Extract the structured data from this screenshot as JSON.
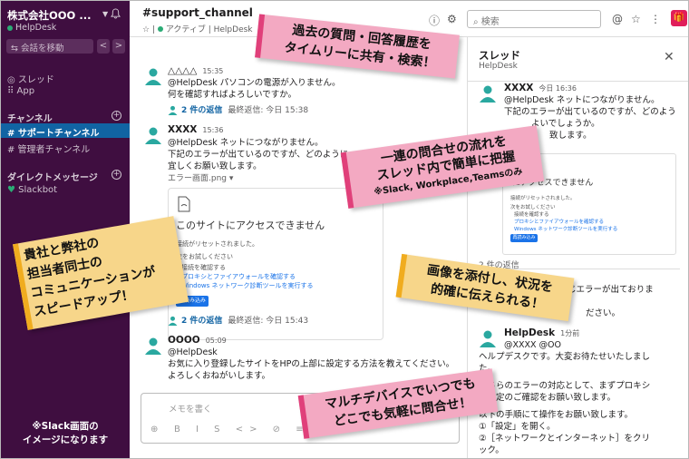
{
  "sidebar": {
    "workspace_name": "株式会社OOO ...",
    "workspace_status": "HelpDesk",
    "jump_label": "会話を移動",
    "threads_label": "スレッド",
    "app_label": "App",
    "channels_header": "チャンネル",
    "channels": [
      {
        "label": "# サポートチャンネル",
        "active": true
      },
      {
        "label": "# 管理者チャンネル",
        "active": false
      }
    ],
    "dm_header": "ダイレクトメッセージ",
    "dm_items": [
      {
        "label": "Slackbot"
      }
    ],
    "note_line1": "※Slack画面の",
    "note_line2": "イメージになります"
  },
  "header": {
    "channel_name": "#support_channel",
    "status": "アクティブ",
    "topic": "HelpDesk",
    "search_placeholder": "検索"
  },
  "messages": [
    {
      "name": "△△△△",
      "time": "15:35",
      "lines": [
        "@HelpDesk パソコンの電源が入りません。",
        "何を確認すればよろしいですか。"
      ],
      "replies": "2 件の返信",
      "last_reply": "最終返信: 今日 15:38"
    },
    {
      "name": "XXXX",
      "time": "15:36",
      "lines": [
        "@HelpDesk ネットにつながりません。",
        "下記のエラーが出ているのですが、どのように",
        "宜しくお願い致します。",
        "エラー画面.png ▾"
      ],
      "file": {
        "title": "このサイトにアクセスできません",
        "sub1": "接続がリセットされました。",
        "sub2": "次をお試しください",
        "links": [
          "接続を確認する",
          "プロキシとファイアウォールを確認する",
          "Windows ネットワーク診断ツールを実行する"
        ],
        "button": "再読み込み"
      },
      "replies": "2 件の返信",
      "last_reply": "最終返信: 今日 15:43"
    },
    {
      "name": "OOOO",
      "time": "05:09",
      "lines": [
        "@HelpDesk",
        "お気に入り登録したサイトをHPの上部に設定する方法を教えてください。",
        "よろしくおねがいします。"
      ]
    }
  ],
  "composer": {
    "placeholder": "メモを書く",
    "tools": "B I S <> ⊘ ≡ ≡"
  },
  "thread": {
    "title": "スレッド",
    "subtitle": "HelpDesk",
    "parent": {
      "name": "XXXX",
      "time": "今日 16:36",
      "lines": [
        "@HelpDesk ネットにつながりません。",
        "下記のエラーが出ているのですが、どのよう",
        "よいでしょうか。",
        "致します。"
      ],
      "file_title": "にアクセスできません",
      "file_sub1": "接続がリセットされました。",
      "file_sub2": "次をお試しください",
      "file_links": [
        "接続を確認する",
        "プロキシとファイアウォールを確認する",
        "Windows ネットワーク診断ツールを実行する"
      ],
      "file_button": "再読み込み"
    },
    "replies_count": "2 件の返信",
    "reply1": {
      "lines": [
        "じエラーが出ておりま",
        "ださい。"
      ]
    },
    "reply2": {
      "name": "HelpDesk",
      "time": "1分前",
      "lines": [
        "@XXXX @OO",
        "ヘルプデスクです。大変お待たせいたしまし",
        "た。",
        "",
        "こちらのエラーの対応として、まずプロキシ",
        "の設定のご確認をお願い致します。",
        "",
        "以下の手順にて操作をお願い致します。",
        "①「設定」を開く。",
        "②［ネットワークとインターネット］をクリ",
        "ック。"
      ]
    }
  },
  "callouts": {
    "c1": [
      "過去の質問・回答履歴を",
      "タイムリーに共有・検索！"
    ],
    "c2": [
      "一連の問合せの流れを",
      "スレッド内で簡単に把握",
      "※Slack, Workplace,Teamsのみ"
    ],
    "c3": [
      "貴社と弊社の",
      "担当者同士の",
      "コミュニケーションが",
      "スピードアップ！"
    ],
    "c4": [
      "画像を添付し、状況を",
      "的確に伝えられる！"
    ],
    "c5": [
      "マルチデバイスでいつでも",
      "どこでも気軽に問合せ！"
    ]
  },
  "colors": {
    "sidebar": "#3f0e40",
    "active_channel": "#1164a3",
    "callout_pink": "#f3a9c2",
    "callout_yellow": "#f7d68a",
    "accent": "#e01e5a"
  }
}
